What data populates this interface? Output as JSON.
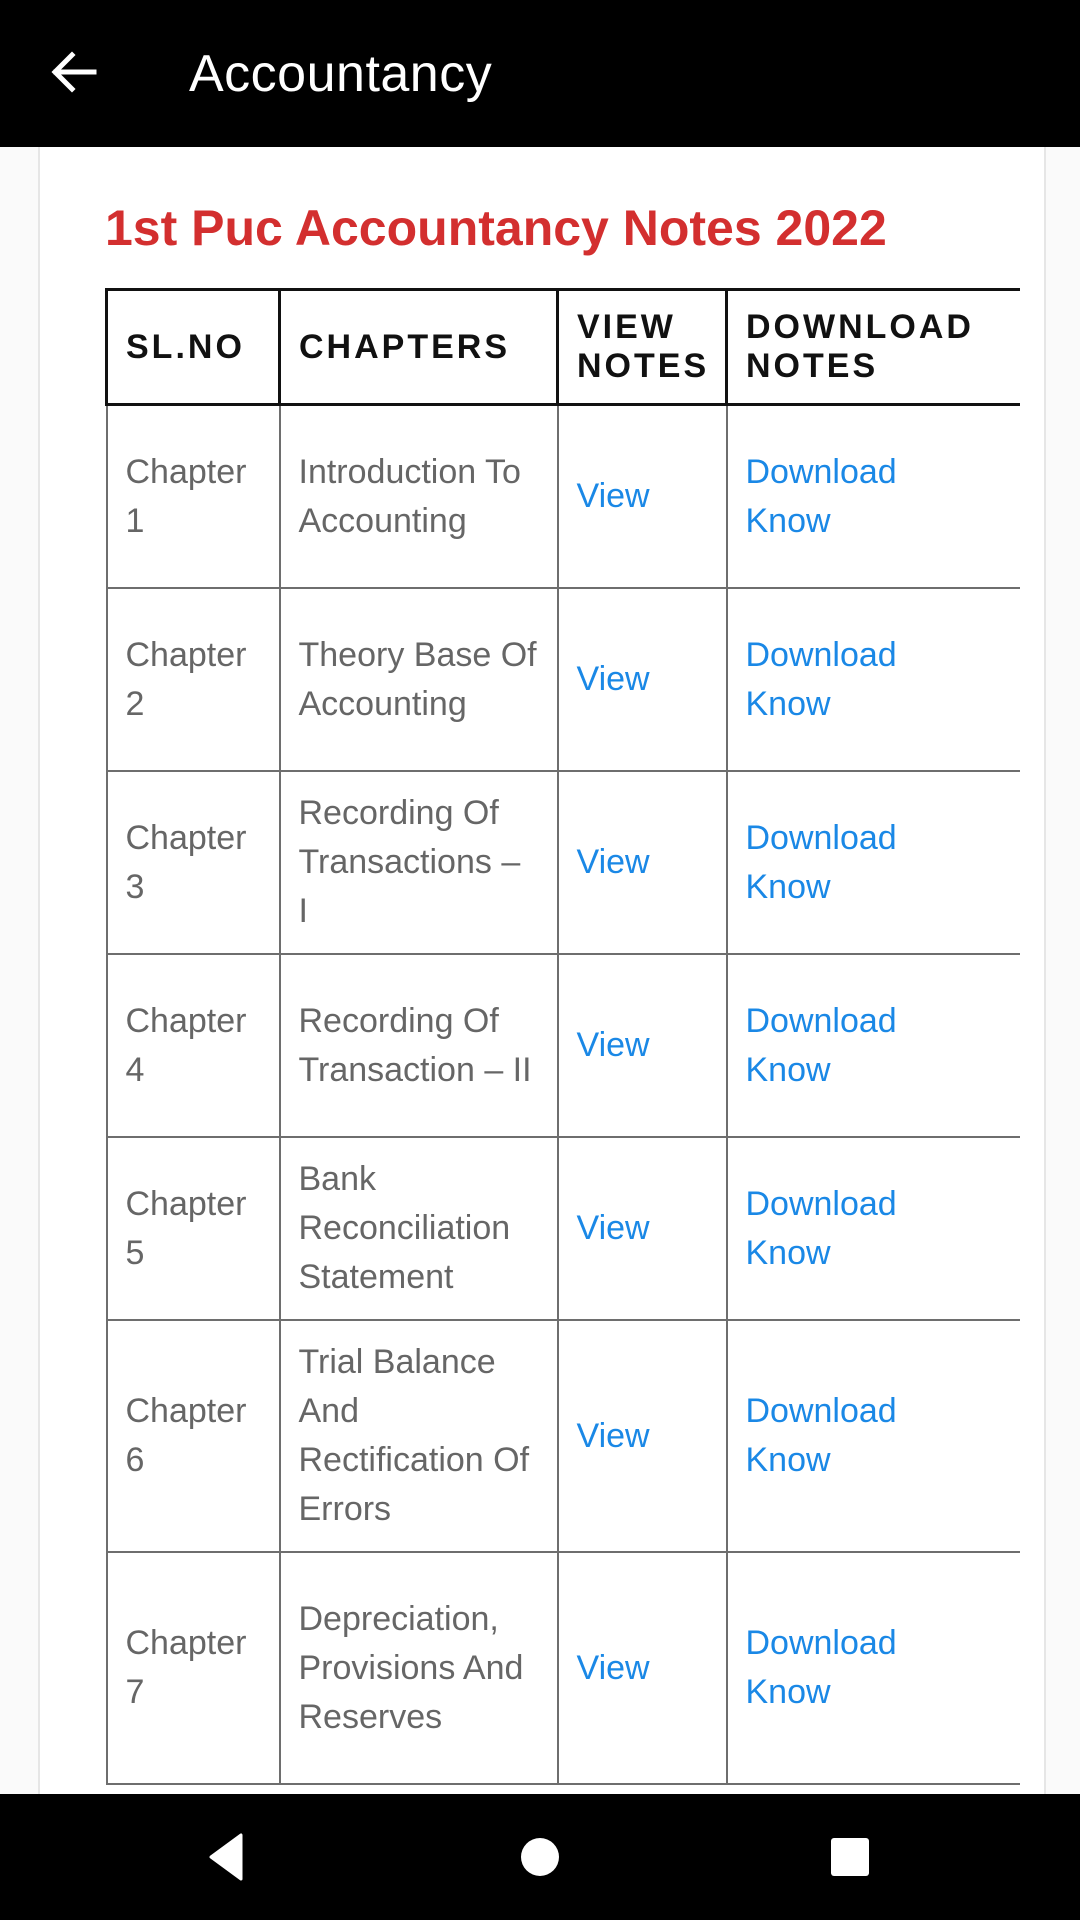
{
  "appbar": {
    "back_icon": "arrow-left-icon",
    "title": "Accountancy"
  },
  "article": {
    "heading": "1st Puc Accountancy Notes 2022",
    "heading_color": "#d32f2f",
    "link_color": "#1a88e6",
    "table": {
      "headers": [
        "SL.NO",
        "CHAPTERS",
        "VIEW NOTES",
        "DOWNLOAD NOTES"
      ],
      "rows": [
        {
          "slno": "Chapter 1",
          "chapter": "Introduction To Accounting",
          "view": "View",
          "download": "Download Know"
        },
        {
          "slno": "Chapter 2",
          "chapter": "Theory Base Of Accounting",
          "view": "View",
          "download": "Download Know"
        },
        {
          "slno": "Chapter 3",
          "chapter": "Recording Of Transactions – I",
          "view": "View",
          "download": "Download Know"
        },
        {
          "slno": "Chapter 4",
          "chapter": "Recording Of Transaction – II",
          "view": "View",
          "download": "Download Know"
        },
        {
          "slno": "Chapter 5",
          "chapter": "Bank Reconciliation Statement",
          "view": "View",
          "download": "Download Know"
        },
        {
          "slno": "Chapter 6",
          "chapter": " Trial Balance And Rectification Of Errors",
          "view": "View",
          "download": "Download Know"
        },
        {
          "slno": "Chapter 7",
          "chapter": "Depreciation, Provisions And Reserves",
          "view": "View",
          "download": "Download Know"
        }
      ]
    }
  },
  "navbar": {
    "back": "nav-back-icon",
    "home": "nav-home-icon",
    "recents": "nav-recents-icon"
  }
}
